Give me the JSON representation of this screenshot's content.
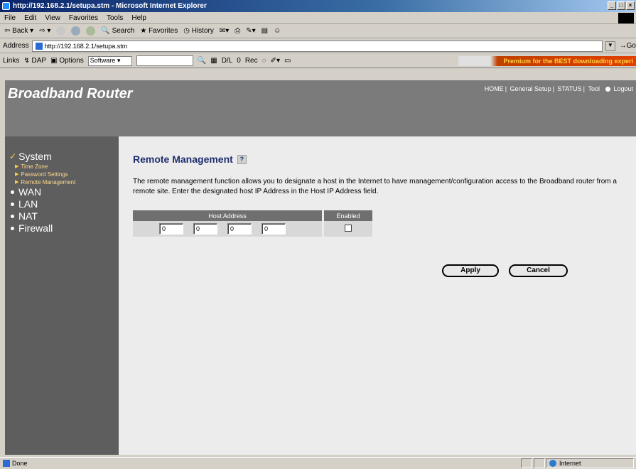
{
  "window": {
    "title": "http://192.168.2.1/setupa.stm - Microsoft Internet Explorer"
  },
  "menu": [
    "File",
    "Edit",
    "View",
    "Favorites",
    "Tools",
    "Help"
  ],
  "toolbar": {
    "back": "Back",
    "search": "Search",
    "favorites": "Favorites",
    "history": "History"
  },
  "address": {
    "label": "Address",
    "url": "http://192.168.2.1/setupa.stm",
    "go": "Go"
  },
  "links": {
    "label": "Links",
    "dap": "DAP",
    "options": "Options",
    "software": "Software",
    "dl": "D/L",
    "dl_count": "0",
    "rec": "Rec",
    "premium": "Premium for the BEST downloading experi"
  },
  "router": {
    "brand": "Broadband Router",
    "nav": {
      "home": "HOME",
      "general_setup": "General Setup",
      "status": "STATUS",
      "tool": "Tool",
      "logout": "Logout"
    }
  },
  "sidebar": {
    "system": "System",
    "sub_items": [
      "Time Zone",
      "Password Settings",
      "Remote Management"
    ],
    "wan": "WAN",
    "lan": "LAN",
    "nat": "NAT",
    "firewall": "Firewall"
  },
  "main": {
    "title": "Remote Management",
    "help": "?",
    "description": "The remote management function allows you to designate a host in the Internet to have management/configuration access to the Broadband router from a remote site. Enter the designated host IP Address in the Host IP Address field.",
    "table": {
      "host_header": "Host Address",
      "enabled_header": "Enabled",
      "octets": [
        "0",
        "0",
        "0",
        "0"
      ],
      "enabled": false
    },
    "apply": "Apply",
    "cancel": "Cancel"
  },
  "status": {
    "text": "Done",
    "zone": "Internet"
  }
}
